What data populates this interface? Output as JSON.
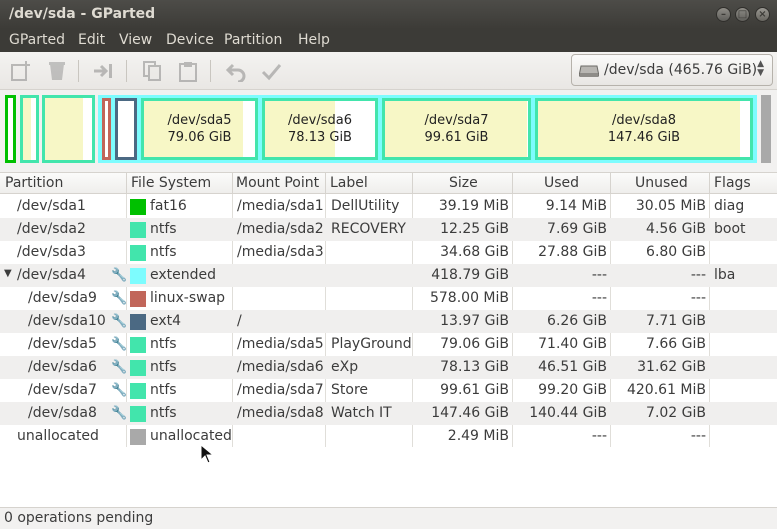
{
  "window": {
    "title": "/dev/sda - GParted"
  },
  "menu": [
    "GParted",
    "Edit",
    "View",
    "Device",
    "Partition",
    "Help"
  ],
  "toolbar": {
    "icons": [
      "new-partition-icon",
      "delete-icon",
      "resize-move-icon",
      "copy-icon",
      "paste-icon",
      "undo-icon",
      "apply-icon"
    ]
  },
  "device_selector": {
    "value": "/dev/sda   (465.76 GiB)"
  },
  "disk_map": [
    {
      "name": "/dev/sda5",
      "size": "79.06 GiB"
    },
    {
      "name": "/dev/sda6",
      "size": "78.13 GiB"
    },
    {
      "name": "/dev/sda7",
      "size": "99.61 GiB"
    },
    {
      "name": "/dev/sda8",
      "size": "147.46 GiB"
    }
  ],
  "columns": [
    "Partition",
    "File System",
    "Mount Point",
    "Label",
    "Size",
    "Used",
    "Unused",
    "Flags"
  ],
  "rows": [
    {
      "partition": "/dev/sda1",
      "fs": "fat16",
      "color": "#00c000",
      "mount": "/media/sda1",
      "label": "DellUtility",
      "size": "39.19 MiB",
      "used": "9.14 MiB",
      "unused": "30.05 MiB",
      "flags": "diag"
    },
    {
      "partition": "/dev/sda2",
      "fs": "ntfs",
      "color": "#42e5ac",
      "mount": "/media/sda2",
      "label": "RECOVERY",
      "size": "12.25 GiB",
      "used": "7.69 GiB",
      "unused": "4.56 GiB",
      "flags": "boot"
    },
    {
      "partition": "/dev/sda3",
      "fs": "ntfs",
      "color": "#42e5ac",
      "mount": "/media/sda3",
      "label": "",
      "size": "34.68 GiB",
      "used": "27.88 GiB",
      "unused": "6.80 GiB",
      "flags": ""
    },
    {
      "partition": "/dev/sda4",
      "fs": "extended",
      "color": "#7dfcfe",
      "mount": "",
      "label": "",
      "size": "418.79 GiB",
      "used": "---",
      "unused": "---",
      "flags": "lba"
    },
    {
      "partition": "/dev/sda9",
      "fs": "linux-swap",
      "color": "#c1665a",
      "mount": "",
      "label": "",
      "size": "578.00 MiB",
      "used": "---",
      "unused": "---",
      "flags": ""
    },
    {
      "partition": "/dev/sda10",
      "fs": "ext4",
      "color": "#4b6983",
      "mount": "/",
      "label": "",
      "size": "13.97 GiB",
      "used": "6.26 GiB",
      "unused": "7.71 GiB",
      "flags": ""
    },
    {
      "partition": "/dev/sda5",
      "fs": "ntfs",
      "color": "#42e5ac",
      "mount": "/media/sda5",
      "label": "PlayGround",
      "size": "79.06 GiB",
      "used": "71.40 GiB",
      "unused": "7.66 GiB",
      "flags": ""
    },
    {
      "partition": "/dev/sda6",
      "fs": "ntfs",
      "color": "#42e5ac",
      "mount": "/media/sda6",
      "label": "eXp",
      "size": "78.13 GiB",
      "used": "46.51 GiB",
      "unused": "31.62 GiB",
      "flags": ""
    },
    {
      "partition": "/dev/sda7",
      "fs": "ntfs",
      "color": "#42e5ac",
      "mount": "/media/sda7",
      "label": "Store",
      "size": "99.61 GiB",
      "used": "99.20 GiB",
      "unused": "420.61 MiB",
      "flags": ""
    },
    {
      "partition": "/dev/sda8",
      "fs": "ntfs",
      "color": "#42e5ac",
      "mount": "/media/sda8",
      "label": "Watch IT",
      "size": "147.46 GiB",
      "used": "140.44 GiB",
      "unused": "7.02 GiB",
      "flags": ""
    },
    {
      "partition": "unallocated",
      "fs": "unallocated",
      "color": "#a9a9a9",
      "mount": "",
      "label": "",
      "size": "2.49 MiB",
      "used": "---",
      "unused": "---",
      "flags": ""
    }
  ],
  "status": "0 operations pending"
}
